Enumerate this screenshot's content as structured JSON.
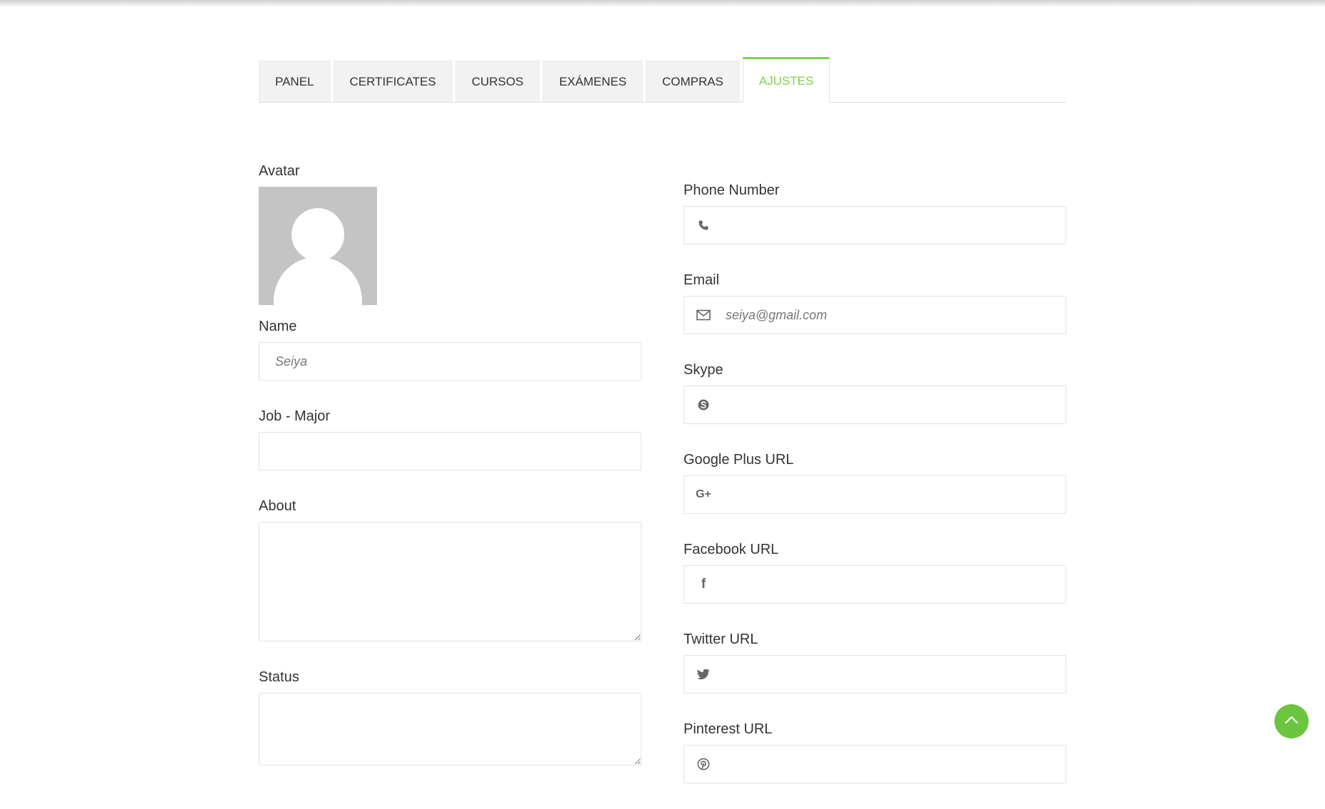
{
  "tabs": [
    {
      "label": "PANEL"
    },
    {
      "label": "CERTIFICATES"
    },
    {
      "label": "CURSOS"
    },
    {
      "label": "EXÁMENES"
    },
    {
      "label": "COMPRAS"
    },
    {
      "label": "AJUSTES",
      "active": true
    }
  ],
  "left": {
    "avatar_label": "Avatar",
    "name_label": "Name",
    "name_placeholder": "Seiya",
    "job_label": "Job - Major",
    "job_value": "",
    "about_label": "About",
    "about_value": "",
    "status_label": "Status",
    "status_value": ""
  },
  "right": {
    "phone_label": "Phone Number",
    "phone_icon": "phone-icon",
    "email_label": "Email",
    "email_placeholder": "seiya@gmail.com",
    "email_icon": "envelope-icon",
    "skype_label": "Skype",
    "skype_icon": "skype-icon",
    "gplus_label": "Google Plus URL",
    "gplus_icon": "google-plus-icon",
    "gplus_glyph": "G+",
    "facebook_label": "Facebook URL",
    "facebook_icon": "facebook-icon",
    "facebook_glyph": "f",
    "twitter_label": "Twitter URL",
    "twitter_icon": "twitter-icon",
    "pinterest_label": "Pinterest URL",
    "pinterest_icon": "pinterest-icon"
  },
  "colors": {
    "accent": "#7ed04a",
    "scroll_top_button": "#6cc53f",
    "tab_bg": "#f2f2f2",
    "avatar_bg": "#c4c4c4"
  },
  "scroll_top_icon": "chevron-up-icon"
}
